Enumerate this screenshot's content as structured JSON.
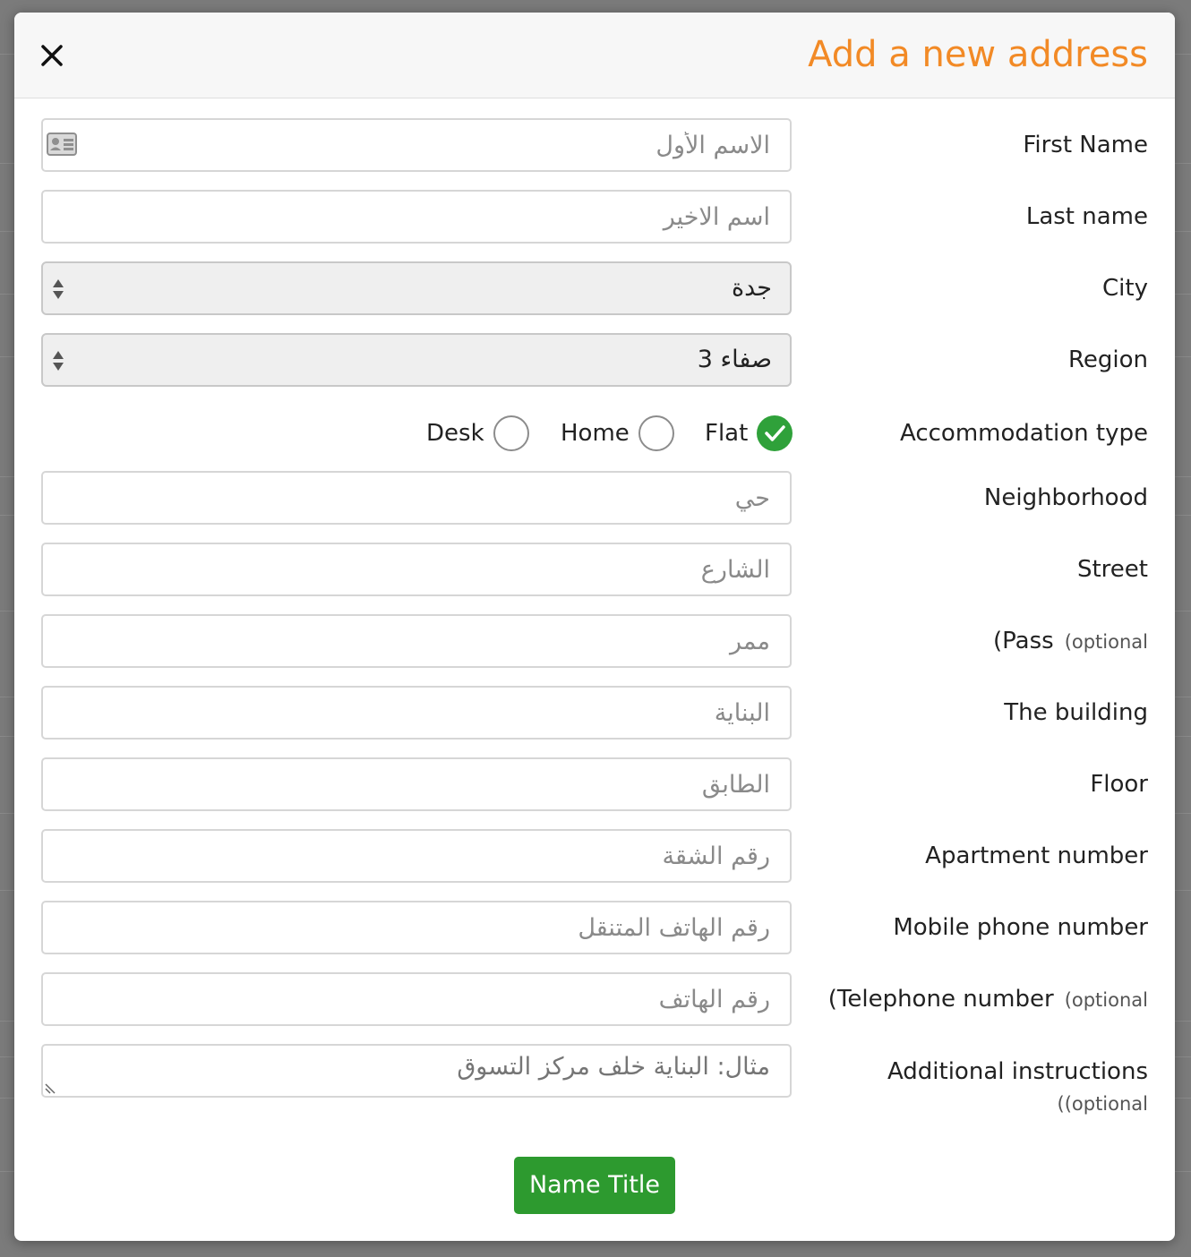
{
  "header": {
    "title": "Add a new address",
    "close_icon": "close-icon"
  },
  "form": {
    "first_name": {
      "label": "First Name",
      "placeholder": "الاسم الأول",
      "icon": "contact-card-icon"
    },
    "last_name": {
      "label": "Last name",
      "placeholder": "اسم الاخير"
    },
    "city": {
      "label": "City",
      "value": "جدة"
    },
    "region": {
      "label": "Region",
      "value": "صفاء 3"
    },
    "accommodation": {
      "label": "Accommodation type",
      "options": [
        {
          "label": "Flat",
          "checked": true
        },
        {
          "label": "Home",
          "checked": false
        },
        {
          "label": "Desk",
          "checked": false
        }
      ]
    },
    "neighborhood": {
      "label": "Neighborhood",
      "placeholder": "حي"
    },
    "street": {
      "label": "Street",
      "placeholder": "الشارع"
    },
    "pass": {
      "label": "(Pass",
      "optional": "(optional",
      "placeholder": "ممر"
    },
    "building": {
      "label": "The building",
      "placeholder": "البناية"
    },
    "floor": {
      "label": "Floor",
      "placeholder": "الطابق"
    },
    "apartment": {
      "label": "Apartment number",
      "placeholder": "رقم الشقة"
    },
    "mobile": {
      "label": "Mobile phone number",
      "placeholder": "رقم الهاتف المتنقل"
    },
    "telephone": {
      "label": "(Telephone number",
      "optional": "(optional",
      "placeholder": "رقم الهاتف"
    },
    "instructions": {
      "label": "Additional instructions",
      "optional": "((optional",
      "placeholder": "مثال: البناية خلف مركز التسوق"
    }
  },
  "submit": {
    "label": "Name Title",
    "color": "#2d9a2f"
  },
  "colors": {
    "title": "#f28a26",
    "radio_checked": "#2fa13a"
  }
}
